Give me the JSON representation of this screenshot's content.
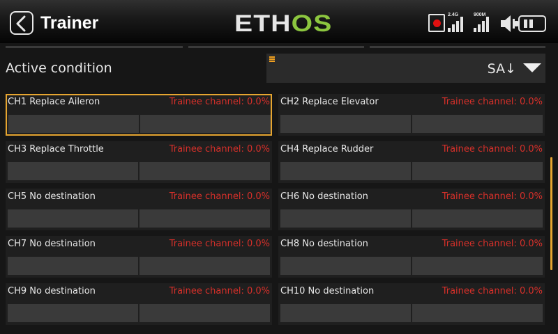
{
  "header": {
    "title": "Trainer",
    "logo_part1": "ETH",
    "logo_part2": "OS",
    "signal1_label": "2.4G",
    "signal2_label": "900M"
  },
  "active_condition": {
    "label": "Active condition",
    "value": "SA↓"
  },
  "channels": [
    {
      "name": "CH1 Replace Aileron",
      "trainee": "Trainee channel: 0.0%"
    },
    {
      "name": "CH2 Replace Elevator",
      "trainee": "Trainee channel: 0.0%"
    },
    {
      "name": "CH3 Replace Throttle",
      "trainee": "Trainee channel: 0.0%"
    },
    {
      "name": "CH4 Replace Rudder",
      "trainee": "Trainee channel: 0.0%"
    },
    {
      "name": "CH5 No destination",
      "trainee": "Trainee channel: 0.0%"
    },
    {
      "name": "CH6 No destination",
      "trainee": "Trainee channel: 0.0%"
    },
    {
      "name": "CH7 No destination",
      "trainee": "Trainee channel: 0.0%"
    },
    {
      "name": "CH8 No destination",
      "trainee": "Trainee channel: 0.0%"
    },
    {
      "name": "CH9 No destination",
      "trainee": "Trainee channel: 0.0%"
    },
    {
      "name": "CH10 No destination",
      "trainee": "Trainee channel: 0.0%"
    }
  ],
  "colors": {
    "accent": "#e6a530",
    "trainee_text": "#d8302a",
    "logo_green": "#8cc63f",
    "record_red": "#e01010"
  },
  "icons": [
    "back-arrow-icon",
    "record-icon",
    "signal-2.4g-icon",
    "signal-900m-icon",
    "speaker-icon",
    "battery-icon",
    "dropdown-arrow-icon"
  ]
}
